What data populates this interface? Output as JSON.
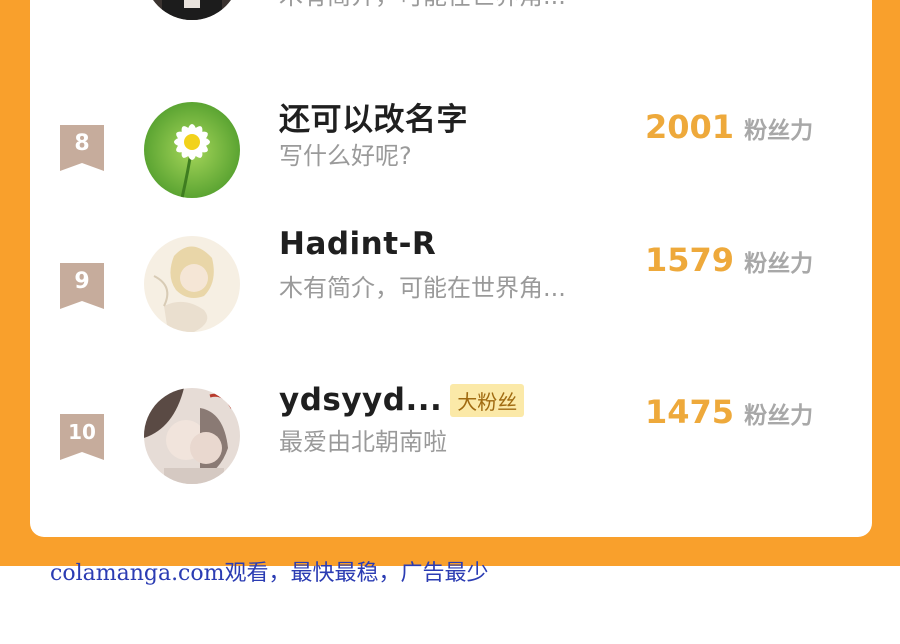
{
  "colors": {
    "accent_orange": "#f9a02c",
    "score_color": "#eea93b",
    "rank_badge": "#c6ac9c",
    "tag_bg": "#fbe9a8"
  },
  "top_partial": {
    "bio": "木有简介，可能在世界角..."
  },
  "rows": [
    {
      "rank": "8",
      "name": "还可以改名字",
      "tag": "",
      "bio": "写什么好呢?",
      "score": "2001",
      "score_label": "粉丝力",
      "avatar_icon": "daisy-flower-avatar"
    },
    {
      "rank": "9",
      "name": "Hadint-R",
      "tag": "",
      "bio": "木有简介，可能在世界角...",
      "score": "1579",
      "score_label": "粉丝力",
      "avatar_icon": "anime-illustration-avatar"
    },
    {
      "rank": "10",
      "name": "ydsyyd...",
      "tag": "大粉丝",
      "bio": "最爱由北朝南啦",
      "score": "1475",
      "score_label": "粉丝力",
      "avatar_icon": "anime-couple-avatar"
    }
  ],
  "watermark": "colamanga.com观看，最快最稳，广告最少"
}
